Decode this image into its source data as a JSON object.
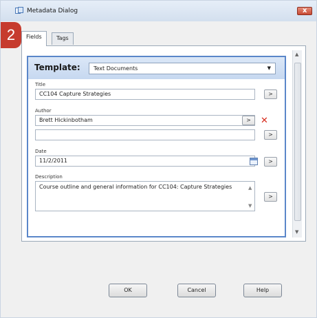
{
  "window": {
    "title": "Metadata Dialog",
    "close_glyph": "x"
  },
  "step_badge": "2",
  "tabs": [
    {
      "label": "Fields",
      "active": true
    },
    {
      "label": "Tags",
      "active": false
    }
  ],
  "template": {
    "label": "Template:",
    "selected": "Text Documents"
  },
  "fields": {
    "title": {
      "label": "Title",
      "value": "CC104 Capture Strategies"
    },
    "author": {
      "label": "Author",
      "value": "Brett Hickinbotham",
      "extra_value": ""
    },
    "date": {
      "label": "Date",
      "value": "11/2/2011"
    },
    "description": {
      "label": "Description",
      "value": "Course outline and general information for CC104: Capture Strategies"
    }
  },
  "select_button_label": ">",
  "remove_icon_glyph": "✕",
  "buttons": {
    "ok": "OK",
    "cancel": "Cancel",
    "help": "Help"
  },
  "colors": {
    "accent": "#5a86c9",
    "badge": "#c63b2e",
    "remove": "#d72a1c"
  }
}
